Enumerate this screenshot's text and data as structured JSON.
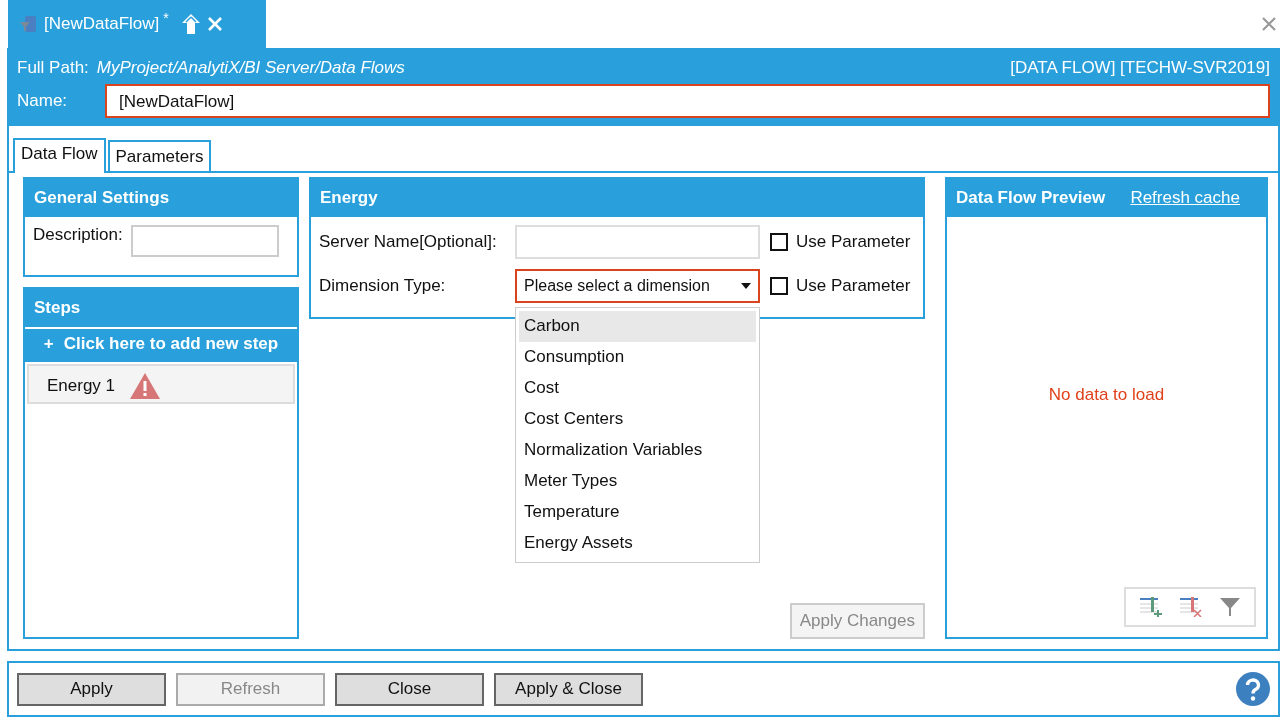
{
  "document_tab": {
    "title": "[NewDataFlow]",
    "modified": "*"
  },
  "header": {
    "full_path_label": "Full Path:",
    "full_path": "MyProject/AnalytiX/BI Server/Data Flows",
    "object_info": "[DATA FLOW] [TECHW-SVR2019]",
    "name_label": "Name:",
    "name_value": "[NewDataFlow]",
    "name_invalid": true
  },
  "tabs": [
    {
      "label": "Data Flow",
      "selected": true
    },
    {
      "label": "Parameters",
      "selected": false
    }
  ],
  "general_settings": {
    "title": "General Settings",
    "description_label": "Description:"
  },
  "steps": {
    "title": "Steps",
    "add_icon": "+",
    "add_label": "Click here to add new step",
    "items": [
      {
        "label": "Energy 1",
        "warning": true
      }
    ]
  },
  "energy": {
    "title": "Energy",
    "fields": [
      {
        "kind": "text",
        "label": "Server Name[Optional]:",
        "invalid": false,
        "use_parameter": "Use Parameter",
        "checked": false
      },
      {
        "kind": "select",
        "label": "Dimension Type:",
        "value": "Please select a dimension",
        "invalid": true,
        "use_parameter": "Use Parameter",
        "checked": false
      }
    ],
    "options": [
      {
        "label": "Carbon",
        "selected": true
      },
      {
        "label": "Consumption",
        "selected": false
      },
      {
        "label": "Cost",
        "selected": false
      },
      {
        "label": "Cost Centers",
        "selected": false
      },
      {
        "label": "Normalization Variables",
        "selected": false
      },
      {
        "label": "Meter Types",
        "selected": false
      },
      {
        "label": "Temperature",
        "selected": false
      },
      {
        "label": "Energy Assets",
        "selected": false
      }
    ],
    "apply_changes": {
      "label": "Apply Changes",
      "disabled": true
    }
  },
  "preview": {
    "title": "Data Flow Preview",
    "refresh_link": "Refresh cache",
    "empty_message": "No data to load"
  },
  "footer_buttons": [
    {
      "label": "Apply",
      "disabled": false
    },
    {
      "label": "Refresh",
      "disabled": true
    },
    {
      "label": "Close",
      "disabled": false
    },
    {
      "label": "Apply & Close",
      "disabled": false
    }
  ]
}
